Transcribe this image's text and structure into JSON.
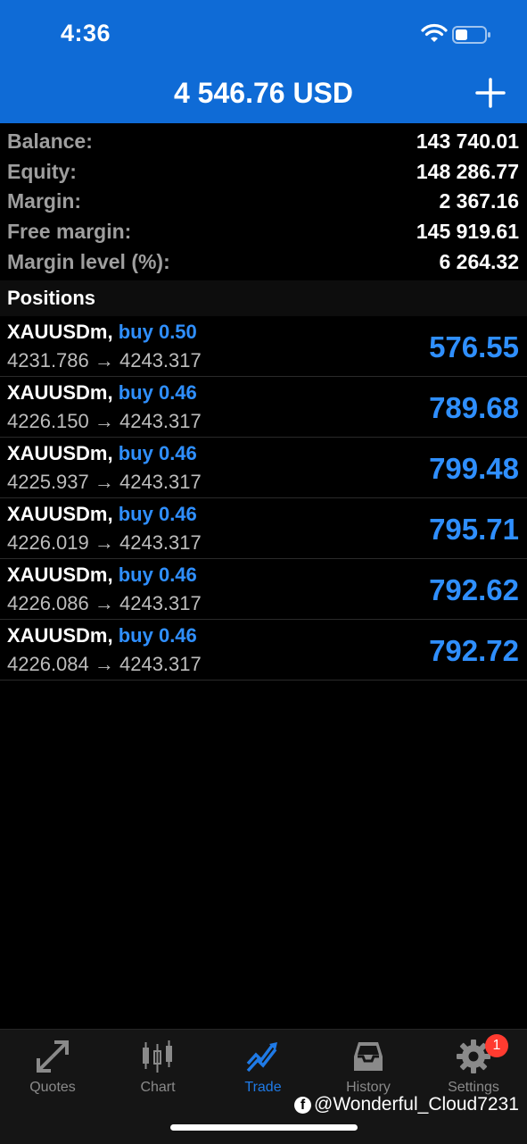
{
  "status_bar": {
    "time": "4:36"
  },
  "header": {
    "title": "4 546.76 USD",
    "add_icon": "plus-icon"
  },
  "summary": [
    {
      "label": "Balance:",
      "value": "143 740.01"
    },
    {
      "label": "Equity:",
      "value": "148 286.77"
    },
    {
      "label": "Margin:",
      "value": "2 367.16"
    },
    {
      "label": "Free margin:",
      "value": "145 919.61"
    },
    {
      "label": "Margin level (%):",
      "value": "6 264.32"
    }
  ],
  "positions_header": "Positions",
  "positions": [
    {
      "symbol": "XAUUSDm,",
      "side": "buy",
      "volume": "0.50",
      "prices": "4231.786 → 4243.317",
      "profit": "576.55"
    },
    {
      "symbol": "XAUUSDm,",
      "side": "buy",
      "volume": "0.46",
      "prices": "4226.150 → 4243.317",
      "profit": "789.68"
    },
    {
      "symbol": "XAUUSDm,",
      "side": "buy",
      "volume": "0.46",
      "prices": "4225.937 → 4243.317",
      "profit": "799.48"
    },
    {
      "symbol": "XAUUSDm,",
      "side": "buy",
      "volume": "0.46",
      "prices": "4226.019 → 4243.317",
      "profit": "795.71"
    },
    {
      "symbol": "XAUUSDm,",
      "side": "buy",
      "volume": "0.46",
      "prices": "4226.086 → 4243.317",
      "profit": "792.62"
    },
    {
      "symbol": "XAUUSDm,",
      "side": "buy",
      "volume": "0.46",
      "prices": "4226.084 → 4243.317",
      "profit": "792.72"
    }
  ],
  "tabs": [
    {
      "label": "Quotes",
      "icon": "quotes-arrows-icon"
    },
    {
      "label": "Chart",
      "icon": "candlestick-icon"
    },
    {
      "label": "Trade",
      "icon": "trade-trend-icon",
      "active": true
    },
    {
      "label": "History",
      "icon": "inbox-tray-icon"
    },
    {
      "label": "Settings",
      "icon": "gear-icon"
    }
  ],
  "settings_badge": "1",
  "watermark": "@Wonderful_Cloud7231",
  "colors": {
    "header_bg": "#0f6bd6",
    "accent": "#2f8fff",
    "badge": "#ff3b30"
  }
}
